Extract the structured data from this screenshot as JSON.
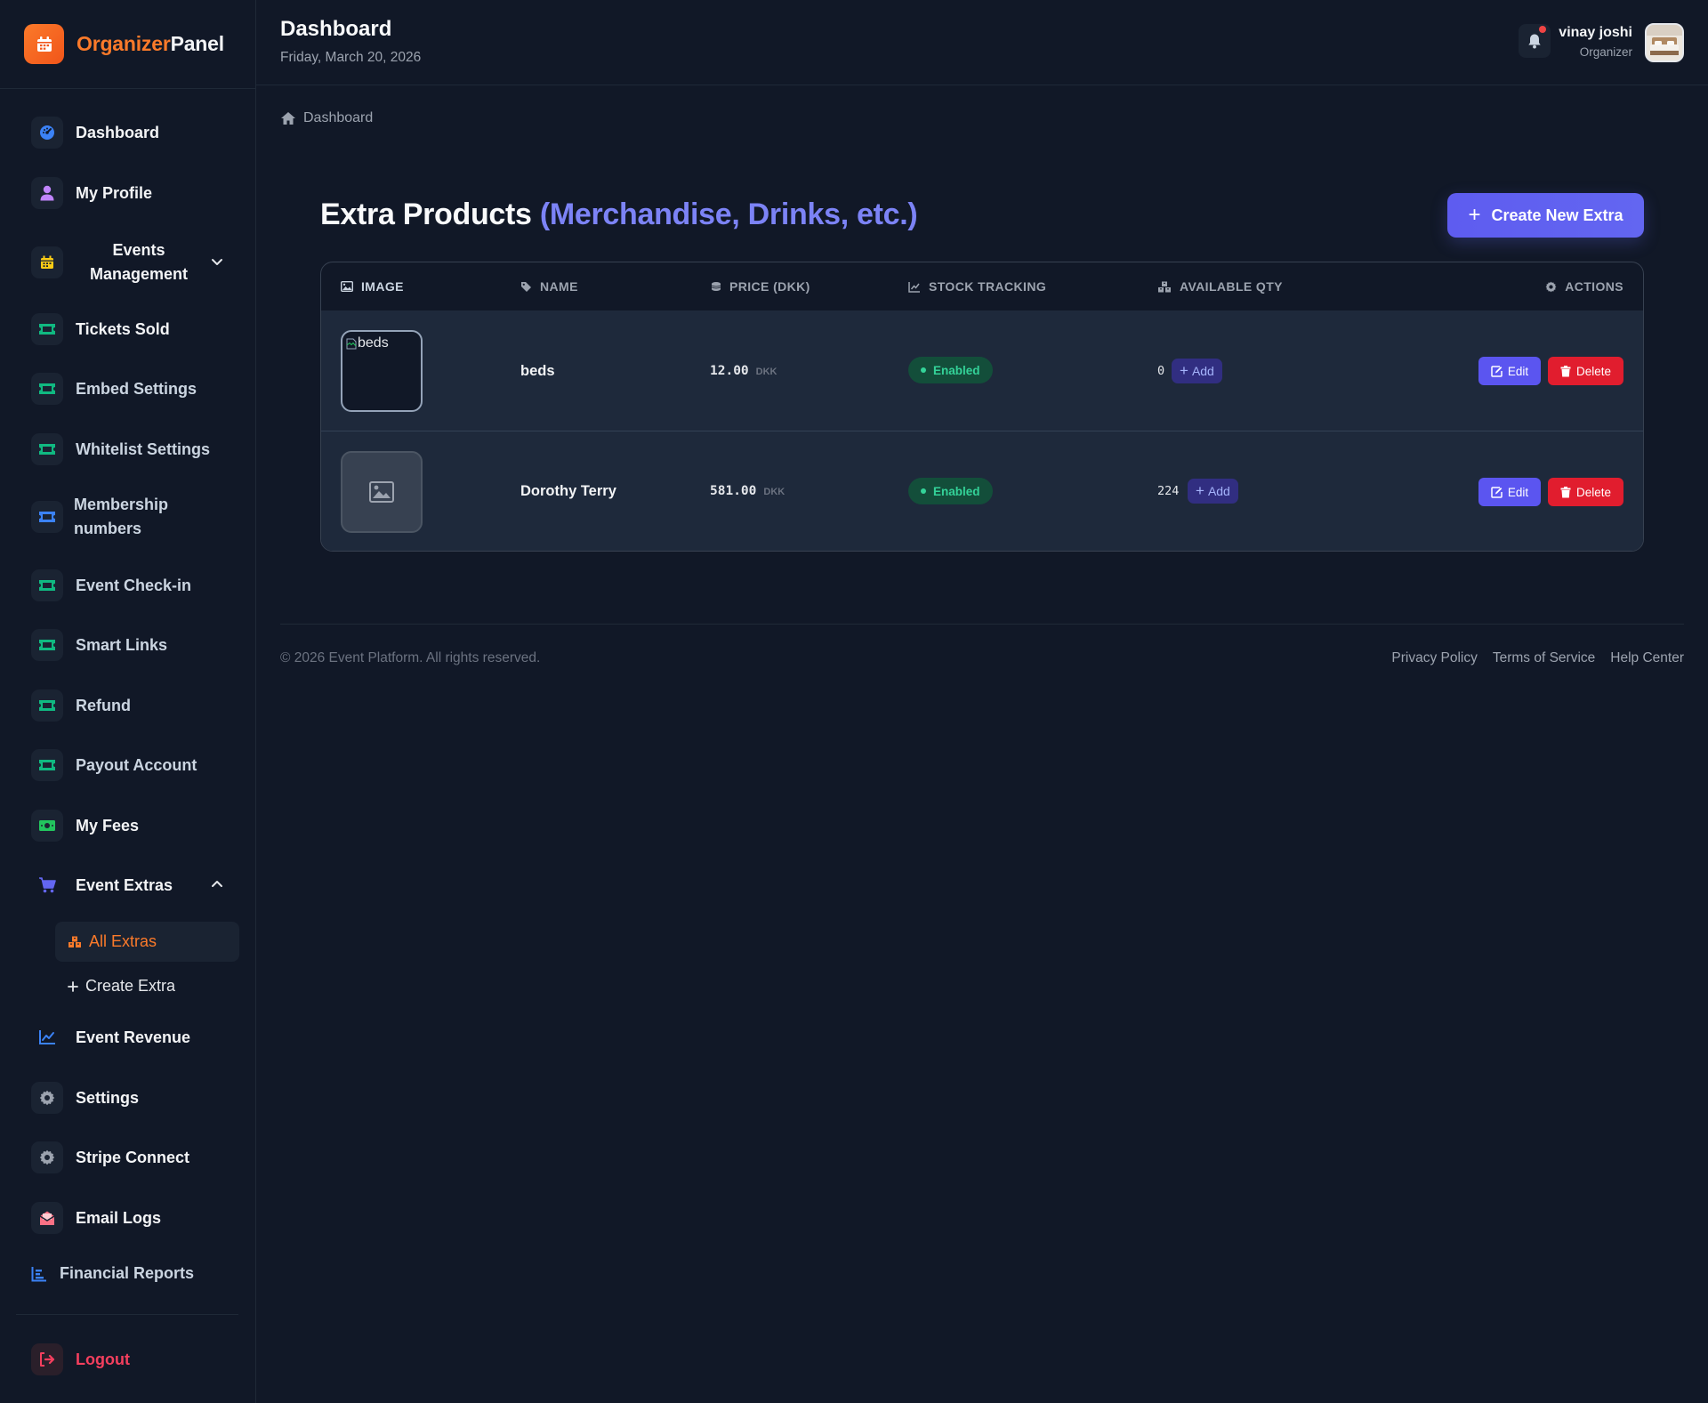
{
  "brand": {
    "part1": "Organizer",
    "part2": "Panel"
  },
  "sidebar": {
    "items": [
      {
        "label": "Dashboard",
        "icon": "dashboard-gauge-icon",
        "color": "#60a5fa"
      },
      {
        "label": "My Profile",
        "icon": "user-icon",
        "color": "#c084fc"
      },
      {
        "label": "Events Management",
        "icon": "calendar-icon",
        "color": "#facc15"
      },
      {
        "label": "Tickets Sold",
        "icon": "ticket-icon",
        "color": "#34d399"
      },
      {
        "label": "Embed Settings",
        "icon": "ticket-icon",
        "color": "#34d399"
      },
      {
        "label": "Whitelist Settings",
        "icon": "ticket-icon",
        "color": "#34d399"
      },
      {
        "label": "Membership numbers",
        "icon": "ticket-icon",
        "color": "#60a5fa"
      },
      {
        "label": "Event Check-in",
        "icon": "ticket-icon",
        "color": "#34d399"
      },
      {
        "label": "Smart Links",
        "icon": "ticket-icon",
        "color": "#34d399"
      },
      {
        "label": "Refund",
        "icon": "ticket-icon",
        "color": "#34d399"
      },
      {
        "label": "Payout Account",
        "icon": "ticket-icon",
        "color": "#34d399"
      },
      {
        "label": "My Fees",
        "icon": "money-icon",
        "color": "#34d399"
      },
      {
        "label": "Event Extras",
        "icon": "cart-icon",
        "color": "#818cf8"
      },
      {
        "label": "Event Revenue",
        "icon": "chart-line-icon",
        "color": "#60a5fa"
      },
      {
        "label": "Settings",
        "icon": "gear-icon",
        "color": "#9ca3af"
      },
      {
        "label": "Stripe Connect",
        "icon": "gear-icon",
        "color": "#9ca3af"
      },
      {
        "label": "Email Logs",
        "icon": "envelope-open-icon",
        "color": "#fb7185"
      },
      {
        "label": "Financial Reports",
        "icon": "bar-chart-icon",
        "color": "#60a5fa"
      },
      {
        "label": "Logout",
        "icon": "logout-icon",
        "color": "#f43f5e"
      }
    ],
    "extras_sub": [
      {
        "label": "All Extras",
        "icon": "boxes-icon"
      },
      {
        "label": "Create Extra",
        "icon": "plus-icon"
      }
    ]
  },
  "header": {
    "title": "Dashboard",
    "date": "Friday, March 20, 2026",
    "user_name": "vinay joshi",
    "user_role": "Organizer"
  },
  "breadcrumb": {
    "label": "Dashboard"
  },
  "main": {
    "title": "Extra Products",
    "title_accent": "(Merchandise, Drinks, etc.)",
    "create_button": "Create New Extra",
    "columns": [
      "IMAGE",
      "NAME",
      "PRICE (DKK)",
      "STOCK TRACKING",
      "AVAILABLE QTY",
      "ACTIONS"
    ],
    "rows": [
      {
        "image_alt": "beds",
        "name": "beds",
        "price": "12.00",
        "currency": "DKK",
        "stock": "Enabled",
        "qty": "0",
        "add": "Add",
        "edit": "Edit",
        "delete": "Delete"
      },
      {
        "image_alt": "",
        "name": "Dorothy Terry",
        "price": "581.00",
        "currency": "DKK",
        "stock": "Enabled",
        "qty": "224",
        "add": "Add",
        "edit": "Edit",
        "delete": "Delete"
      }
    ]
  },
  "footer": {
    "copyright": "© 2026 Event Platform. All rights reserved.",
    "links": [
      "Privacy Policy",
      "Terms of Service",
      "Help Center"
    ]
  },
  "colors": {
    "brand_orange": "#fb7a2a",
    "accent_indigo": "#6366f1",
    "danger": "#e11d2e",
    "success": "#34d399",
    "background": "#111827"
  }
}
